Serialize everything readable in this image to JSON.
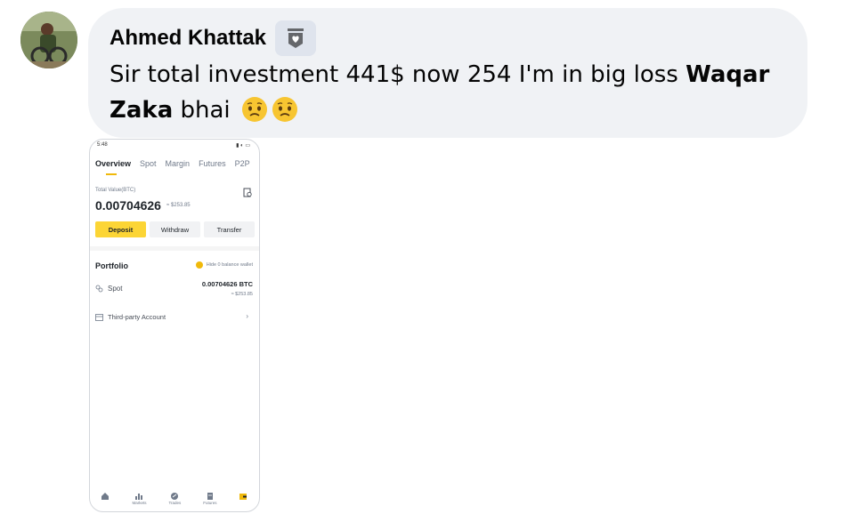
{
  "comment": {
    "author": "Ahmed Khattak",
    "text_main": "Sir total investment 441$ now 254 I'm in big loss ",
    "mention": "Waqar Zaka",
    "text_after": " bhai",
    "emojis": [
      "worried-face",
      "worried-face"
    ]
  },
  "phone": {
    "status_time": "5:48",
    "tabs": [
      "Overview",
      "Spot",
      "Margin",
      "Futures",
      "P2P"
    ],
    "active_tab": "Overview",
    "total_value_label": "Total Value(BTC)",
    "total_value": "0.00704626",
    "total_value_usd": "≈ $253.85",
    "buttons": {
      "deposit": "Deposit",
      "withdraw": "Withdraw",
      "transfer": "Transfer"
    },
    "portfolio_title": "Portfolio",
    "hide_zero_label": "Hide 0 balance wallet",
    "spot_label": "Spot",
    "spot_value": "0.00704626 BTC",
    "spot_usd": "≈ $253.85",
    "third_party_label": "Third-party Account",
    "bottom_nav": [
      "",
      "Markets",
      "Trades",
      "Futures",
      ""
    ],
    "accent_color": "#fcd535"
  }
}
